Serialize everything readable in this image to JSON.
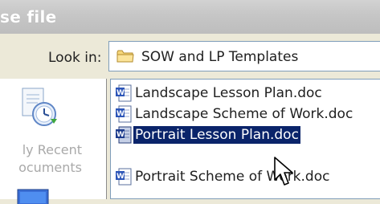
{
  "window": {
    "title": "se file"
  },
  "toolbar": {
    "look_in_label": "Look in:",
    "look_in_value": "SOW and LP Templates",
    "folder_icon": "folder-icon"
  },
  "places_bar": {
    "recent_label_line1": "ly Recent",
    "recent_label_line2": "ocuments"
  },
  "files": [
    {
      "name": "Landscape Lesson Plan.doc",
      "icon": "word-doc-icon",
      "selected": false
    },
    {
      "name": "Landscape Scheme of Work.doc",
      "icon": "word-doc-icon",
      "selected": false
    },
    {
      "name": "Portrait Lesson Plan.doc",
      "icon": "word-doc-icon",
      "selected": true
    },
    {
      "name": "Portrait Scheme of Work.doc",
      "icon": "word-doc-icon",
      "selected": false
    }
  ],
  "colors": {
    "selection": "#0a246a",
    "window_bg": "#ece9d8",
    "titlebar": "#c6c6c6"
  }
}
